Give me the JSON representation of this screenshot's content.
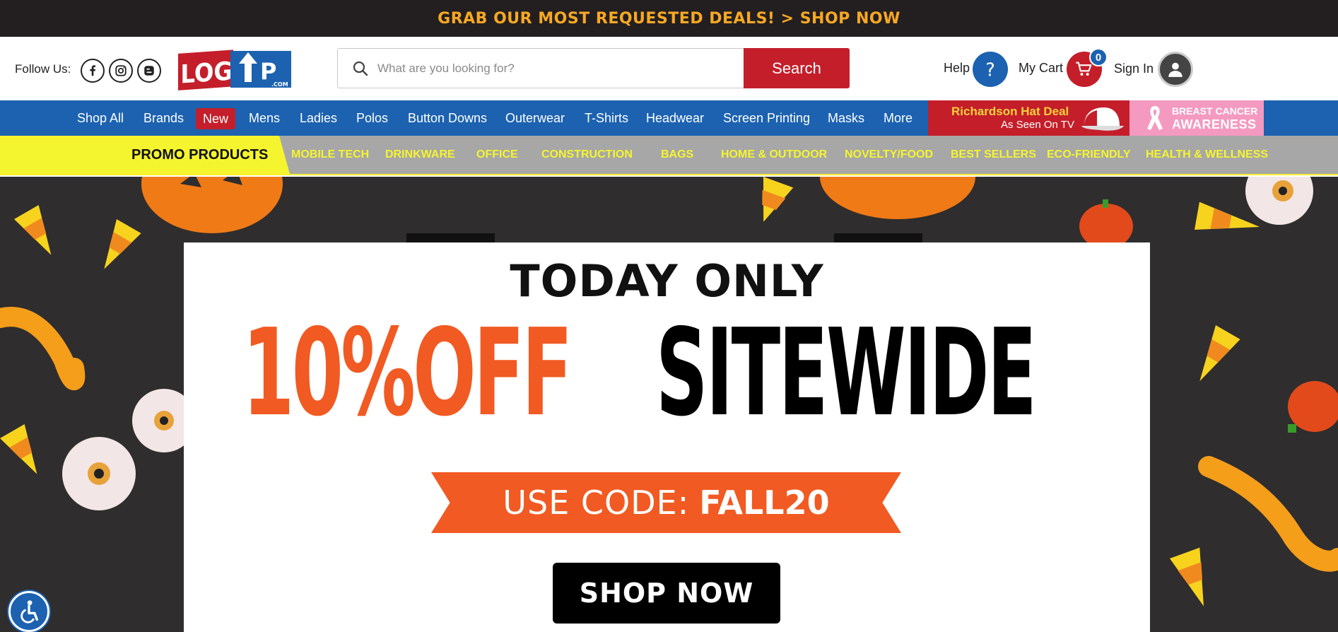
{
  "topbar": {
    "text": "GRAB OUR MOST REQUESTED DEALS! > SHOP NOW"
  },
  "header": {
    "follow_label": "Follow Us:",
    "social": [
      "facebook-icon",
      "instagram-icon",
      "blogger-icon"
    ],
    "logo_text": "LOGO UP .COM",
    "search": {
      "placeholder": "What are you looking for?",
      "button": "Search"
    },
    "help_label": "Help",
    "cart_label": "My Cart",
    "cart_count": "0",
    "signin_label": "Sign In"
  },
  "nav": {
    "items": [
      "Shop All",
      "Brands",
      "New",
      "Mens",
      "Ladies",
      "Polos",
      "Button Downs",
      "Outerwear",
      "T-Shirts",
      "Headwear",
      "Screen Printing",
      "Masks",
      "More"
    ],
    "hat_deal": {
      "title": "Richardson Hat Deal",
      "subtitle": "As Seen On TV"
    },
    "bca": {
      "line1": "BREAST CANCER",
      "line2": "AWARENESS"
    }
  },
  "promo": {
    "label": "PROMO PRODUCTS",
    "categories": [
      "MOBILE TECH",
      "DRINKWARE",
      "OFFICE",
      "CONSTRUCTION",
      "BAGS",
      "HOME & OUTDOOR",
      "NOVELTY/FOOD",
      "BEST SELLERS",
      "ECO-FRIENDLY",
      "HEALTH & WELLNESS"
    ]
  },
  "hero": {
    "today": "TODAY ONLY",
    "discount": "10%OFF",
    "sitewide": "SITEWIDE",
    "code_prefix": "USE CODE:",
    "code": "FALL20",
    "shop_now": "SHOP NOW"
  },
  "colors": {
    "topbar_bg": "#231f20",
    "topbar_text": "#f7a823",
    "brand_red": "#c41e2a",
    "brand_blue": "#1c62b0",
    "promo_yellow": "#f5f52f",
    "hero_orange": "#f15a22"
  }
}
